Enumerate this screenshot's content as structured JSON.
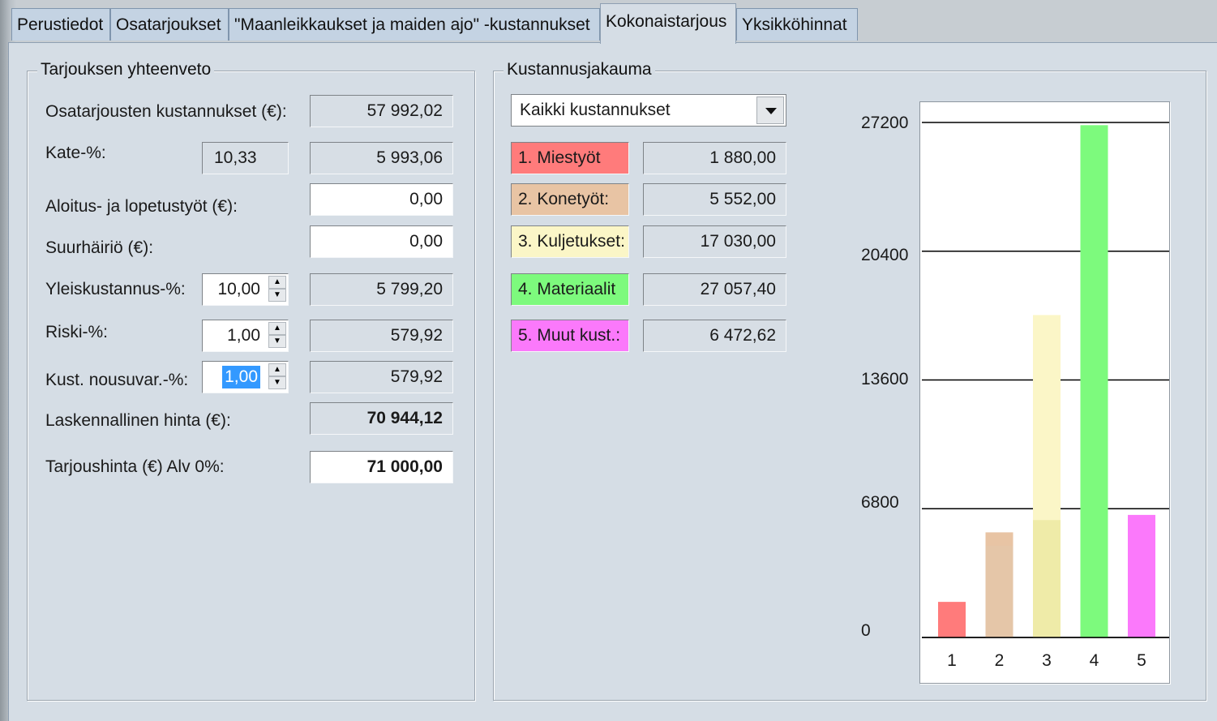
{
  "tabs": [
    {
      "label": "Perustiedot"
    },
    {
      "label": "Osatarjoukset"
    },
    {
      "label": "\"Maanleikkaukset ja maiden ajo\" -kustannukset"
    },
    {
      "label": "Kokonaistarjous"
    },
    {
      "label": "Yksikköhinnat"
    }
  ],
  "summary": {
    "title": "Tarjouksen yhteenveto",
    "rows": {
      "osatarjoukset": {
        "label": "Osatarjousten kustannukset (€):",
        "value": "57 992,02"
      },
      "kate": {
        "label": "Kate-%:",
        "percent": "10,33",
        "value": "5 993,06"
      },
      "aloitus": {
        "label": "Aloitus- ja lopetustyöt (€):",
        "value": "0,00"
      },
      "suurhairio": {
        "label": "Suurhäiriö (€):",
        "value": "0,00"
      },
      "yleiskustannus": {
        "label": "Yleiskustannus-%:",
        "percent": "10,00",
        "value": "5 799,20"
      },
      "riski": {
        "label": "Riski-%:",
        "percent": "1,00",
        "value": "579,92"
      },
      "nousuvar": {
        "label": "Kust. nousuvar.-%:",
        "percent": "1,00",
        "value": "579,92"
      },
      "laskennallinen": {
        "label": "Laskennallinen hinta (€):",
        "value": "70 944,12"
      },
      "tarjoushinta": {
        "label": "Tarjoushinta (€) Alv 0%:",
        "value": "71 000,00"
      }
    }
  },
  "distribution": {
    "title": "Kustannusjakauma",
    "selected_option": "Kaikki kustannukset",
    "items": [
      {
        "label": "1. Miestyöt",
        "value": "1 880,00",
        "color": "#ff7b7b"
      },
      {
        "label": "2. Konetyöt:",
        "value": "5 552,00",
        "color": "#e8c4a4"
      },
      {
        "label": "3. Kuljetukset:",
        "value": "17 030,00",
        "color": "#fbf6c7"
      },
      {
        "label": "4. Materiaalit",
        "value": "27 057,40",
        "color": "#7dfa7d"
      },
      {
        "label": "5. Muut kust.:",
        "value": "6 472,62",
        "color": "#fb79fb"
      }
    ]
  },
  "chart_data": {
    "type": "bar",
    "categories": [
      "1",
      "2",
      "3",
      "4",
      "5"
    ],
    "values": [
      1880,
      5552,
      17030,
      27057.4,
      6472.62
    ],
    "overlay_values": [
      null,
      4850,
      6200,
      null,
      null
    ],
    "colors": [
      "#ff7b7b",
      "#e8c4a4",
      "#fbf6c7",
      "#7dfa7d",
      "#fb79fb"
    ],
    "overlay_colors": [
      null,
      "#e5c6a8",
      "#efeba8",
      null,
      null
    ],
    "y_ticks": [
      "0",
      "6800",
      "13600",
      "20400",
      "27200"
    ],
    "ylim": [
      0,
      27200
    ],
    "grid": true
  }
}
